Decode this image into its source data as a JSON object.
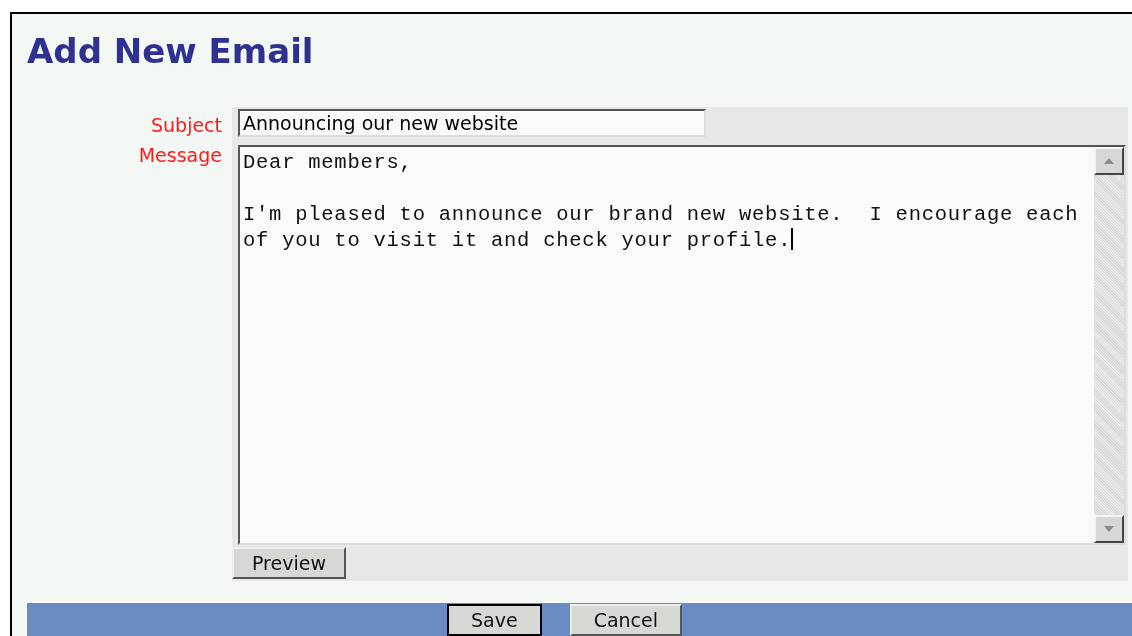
{
  "title": "Add New Email",
  "subject": {
    "label": "Subject",
    "value": "Announcing our new website"
  },
  "message": {
    "label": "Message",
    "value": "Dear members,\n\nI'm pleased to announce our brand new website.  I encourage each\nof you to visit it and check your profile."
  },
  "preview_button": "Preview",
  "footer_buttons": [
    {
      "label": "Save",
      "selected": true
    },
    {
      "label": "Cancel",
      "selected": false
    }
  ]
}
